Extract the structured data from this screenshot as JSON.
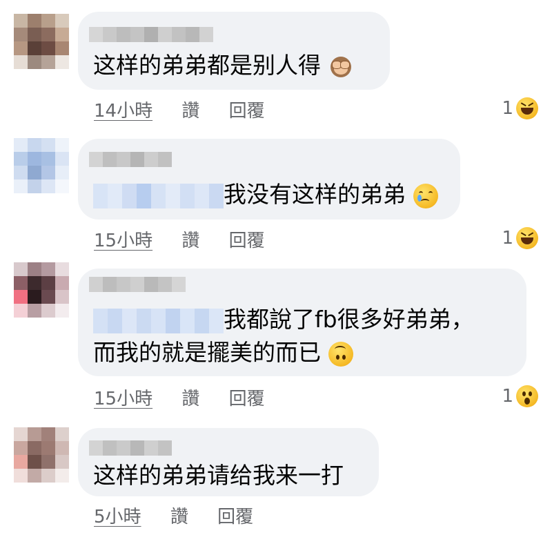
{
  "comments": [
    {
      "text_line1": "这样的弟弟都是别人得",
      "emoji": "see-no-evil-monkey-emoji",
      "time": "14小時",
      "like": "讚",
      "reply": "回覆",
      "reaction_count": "1",
      "reaction_icon": "laughing-reaction-icon"
    },
    {
      "text_line1": "我没有这样的弟弟",
      "emoji": "crying-face-emoji",
      "time": "15小時",
      "like": "讚",
      "reply": "回覆",
      "reaction_count": "1",
      "reaction_icon": "laughing-reaction-icon"
    },
    {
      "text_line1": "我都說了fb很多好弟弟，",
      "text_line2": "而我的就是擺美的而已",
      "emoji": "upside-down-face-emoji",
      "time": "15小時",
      "like": "讚",
      "reply": "回覆",
      "reaction_count": "1",
      "reaction_icon": "wow-reaction-icon"
    },
    {
      "text_line1": "这样的弟弟请给我来一打",
      "time": "5小時",
      "like": "讚",
      "reply": "回覆"
    }
  ],
  "colors": {
    "bubble": "#f0f2f5",
    "meta_text": "#65676b",
    "body_text": "#050505",
    "reaction_yellow": "#f5b925"
  }
}
